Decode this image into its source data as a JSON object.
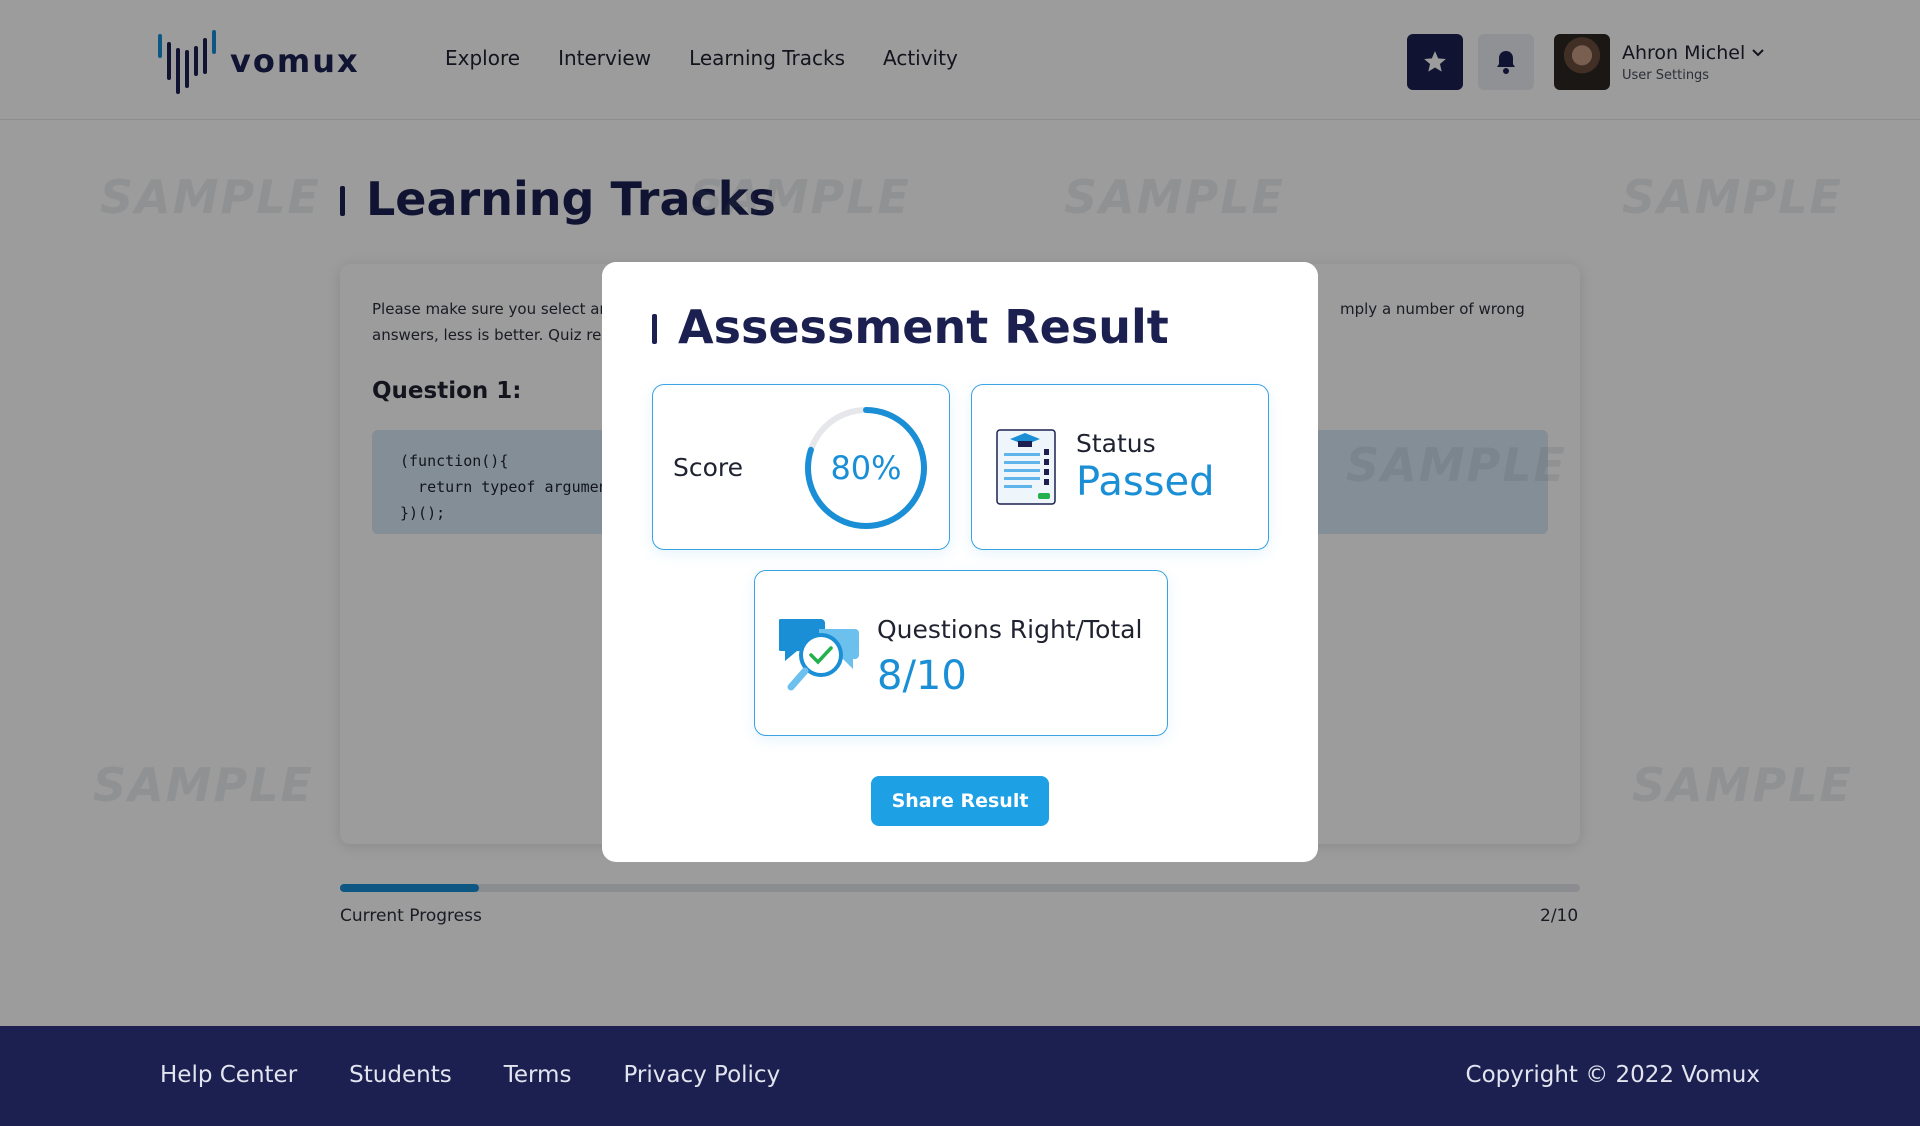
{
  "header": {
    "logo_text": "vomux",
    "nav": [
      "Explore",
      "Interview",
      "Learning Tracks",
      "Activity"
    ],
    "user": {
      "name": "Ahron Michel",
      "subtitle": "User Settings"
    }
  },
  "watermark_text": "SAMPLE",
  "page": {
    "title": "Learning Tracks",
    "instructions_visible": [
      "Please make sure you select ar",
      "answers, less is better. Quiz requ",
      "mply a number of wrong"
    ],
    "question_title": "Question 1:",
    "code_lines": [
      "(function(){",
      "  return typeof arguments.",
      "})();"
    ],
    "progress": {
      "label": "Current Progress",
      "count": "2/10",
      "fraction": 0.2
    }
  },
  "modal": {
    "title": "Assessment Result",
    "score_label": "Score",
    "score_value": "80%",
    "score_fraction": 0.8,
    "status_label": "Status",
    "status_value": "Passed",
    "qr_label": "Questions Right/Total",
    "qr_value": "8/10",
    "share_button": "Share Result"
  },
  "footer": {
    "links": [
      "Help Center",
      "Students",
      "Terms",
      "Privacy Policy"
    ],
    "copyright": "Copyright © 2022 Vomux"
  },
  "colors": {
    "navy": "#1b2050",
    "accent_blue": "#1a8fd6",
    "button_blue": "#1ea0e4",
    "card_border": "#3aa3e3",
    "overlay": "rgba(0,0,0,0.39)"
  }
}
